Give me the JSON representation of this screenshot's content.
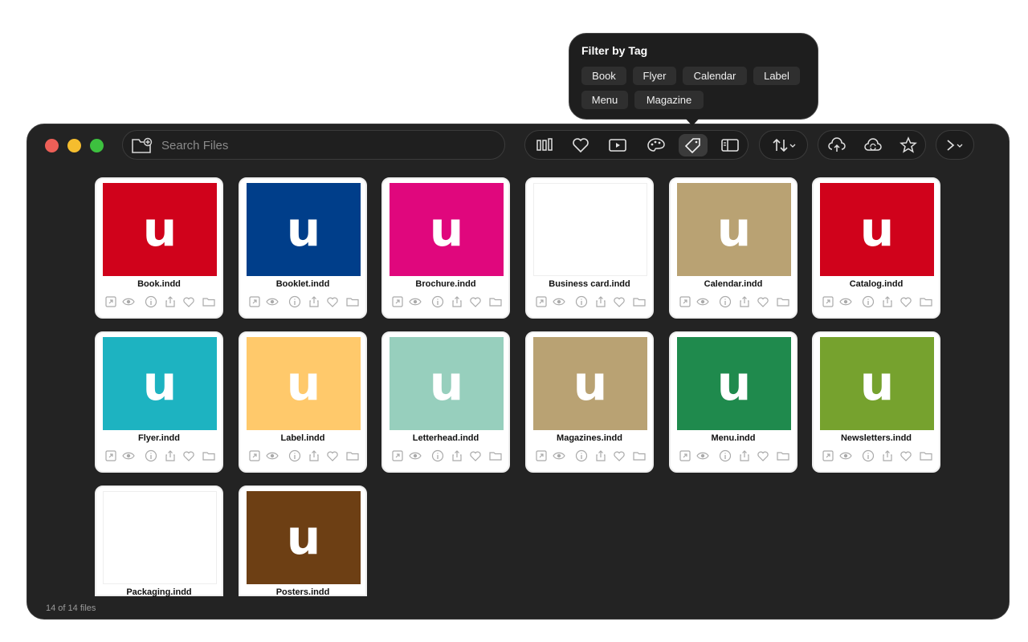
{
  "toolbar": {
    "search_placeholder": "Search Files",
    "icons": [
      "folder-add-icon",
      "library-icon",
      "heart-icon",
      "play-icon",
      "palette-icon",
      "tag-icon",
      "sidebar-icon",
      "sort-icon",
      "upload-cloud-icon",
      "sync-cloud-icon",
      "star-icon",
      "chevron-right-icon"
    ]
  },
  "popover": {
    "title": "Filter by Tag",
    "tags": [
      "Book",
      "Flyer",
      "Calendar",
      "Label",
      "Menu",
      "Magazine"
    ]
  },
  "files": [
    {
      "name": "Book.indd",
      "color": "#d0021b"
    },
    {
      "name": "Booklet.indd",
      "color": "#003e8a"
    },
    {
      "name": "Brochure.indd",
      "color": "#e0077d"
    },
    {
      "name": "Business card.indd",
      "color": "#ffffff"
    },
    {
      "name": "Calendar.indd",
      "color": "#b9a273"
    },
    {
      "name": "Catalog.indd",
      "color": "#d0021b"
    },
    {
      "name": "Flyer.indd",
      "color": "#1db3c1"
    },
    {
      "name": "Label.indd",
      "color": "#ffc96b"
    },
    {
      "name": "Letterhead.indd",
      "color": "#97cfbd"
    },
    {
      "name": "Magazines.indd",
      "color": "#b9a273"
    },
    {
      "name": "Menu.indd",
      "color": "#1f8a4d"
    },
    {
      "name": "Newsletters.indd",
      "color": "#76a22e"
    },
    {
      "name": "Packaging.indd",
      "color": "#ffffff"
    },
    {
      "name": "Posters.indd",
      "color": "#6d3f14"
    }
  ],
  "status": "14 of 14 files"
}
